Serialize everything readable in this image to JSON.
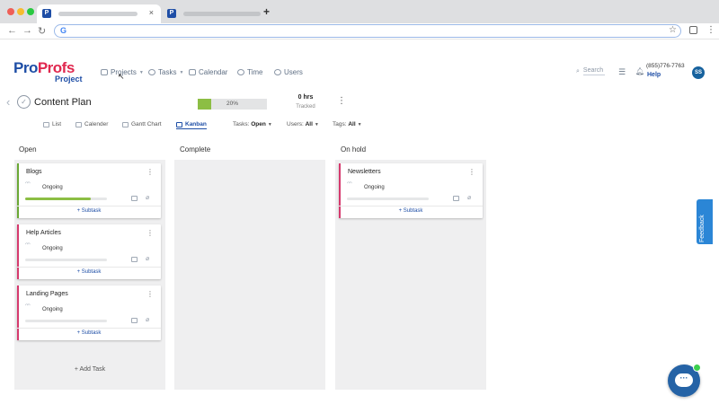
{
  "browser": {
    "new_tab": "+",
    "tab_close": "×",
    "nav_back": "←",
    "nav_forward": "→",
    "nav_reload": "↻",
    "favicon_letter": "P"
  },
  "app": {
    "logo_part1": "Pro",
    "logo_part2": "Profs",
    "logo_sub": "Project",
    "nav": [
      {
        "label": "Projects",
        "icon": "briefcase-icon"
      },
      {
        "label": "Tasks",
        "icon": "check-circle-icon"
      },
      {
        "label": "Calendar",
        "icon": "calendar-icon"
      },
      {
        "label": "Time",
        "icon": "clock-icon"
      },
      {
        "label": "Users",
        "icon": "user-icon"
      }
    ],
    "search_label": "Search",
    "phone": "(855)776-7763",
    "help": "Help",
    "avatar": "SS"
  },
  "project": {
    "title": "Content Plan",
    "progress_percent": 20,
    "progress_label": "20%",
    "hours": "0 hrs",
    "tracked": "Tracked"
  },
  "views": {
    "list": "List",
    "calendar": "Calender",
    "gantt": "Gantt Chart",
    "kanban": "Kanban"
  },
  "filters": {
    "tasks_label": "Tasks:",
    "tasks_value": "Open",
    "users_label": "Users:",
    "users_value": "All",
    "tags_label": "Tags:",
    "tags_value": "All"
  },
  "columns": {
    "open": "Open",
    "complete": "Complete",
    "on_hold": "On hold"
  },
  "cards": [
    {
      "title": "Blogs",
      "status": "Ongoing",
      "progress": 0.8,
      "stripe": "#6aa834",
      "subtask": "+ Subtask"
    },
    {
      "title": "Help Articles",
      "status": "Ongoing",
      "progress": 0,
      "stripe": "#d63a6e",
      "subtask": "+ Subtask"
    },
    {
      "title": "Landing Pages",
      "status": "Ongoing",
      "progress": 0,
      "stripe": "#d63a6e",
      "subtask": "+ Subtask"
    },
    {
      "title": "Newsletters",
      "status": "Ongoing",
      "progress": 0,
      "stripe": "#d63a6e",
      "subtask": "+ Subtask"
    }
  ],
  "add_task": "+ Add Task",
  "feedback": "Feedback",
  "colors": {
    "brand_blue": "#1e4ea6",
    "brand_red": "#e0284f",
    "progress_green": "#8cbe44"
  }
}
